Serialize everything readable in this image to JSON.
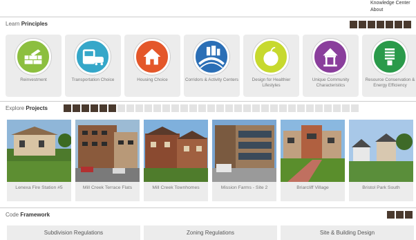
{
  "topnav": {
    "items": [
      "Knowledge Center",
      "About"
    ]
  },
  "learn": {
    "prefix": "Learn",
    "title": "Principles",
    "cards": [
      {
        "label": "Reinvestment",
        "icon": "bricks-icon",
        "color": "#8cbf3f"
      },
      {
        "label": "Transportation Choice",
        "icon": "bus-icon",
        "color": "#35a7c9"
      },
      {
        "label": "Housing Choice",
        "icon": "house-icon",
        "color": "#e4572a"
      },
      {
        "label": "Corridors & Activity Centers",
        "icon": "corridor-icon",
        "color": "#2b6fb6"
      },
      {
        "label": "Design for Healthier Lifestyles",
        "icon": "apple-icon",
        "color": "#c7d92e"
      },
      {
        "label": "Unique Community Characteristics",
        "icon": "gazebo-icon",
        "color": "#8a3e9c"
      },
      {
        "label": "Resource Conservation & Energy Efficiency",
        "icon": "bulb-icon",
        "color": "#2a9a4a"
      }
    ]
  },
  "explore": {
    "prefix": "Explore",
    "title": "Projects",
    "projects": [
      {
        "label": "Lenexa Fire Station #5"
      },
      {
        "label": "Mill Creek Terrace Flats"
      },
      {
        "label": "Mill Creek Townhomes"
      },
      {
        "label": "Mission Farms - Site 2"
      },
      {
        "label": "Briarcliff Village"
      },
      {
        "label": "Bristol Park South"
      }
    ]
  },
  "code": {
    "prefix": "Code",
    "title": "Framework",
    "buttons": [
      "Subdivision Regulations",
      "Zoning Regulations",
      "Site & Building Design"
    ]
  }
}
